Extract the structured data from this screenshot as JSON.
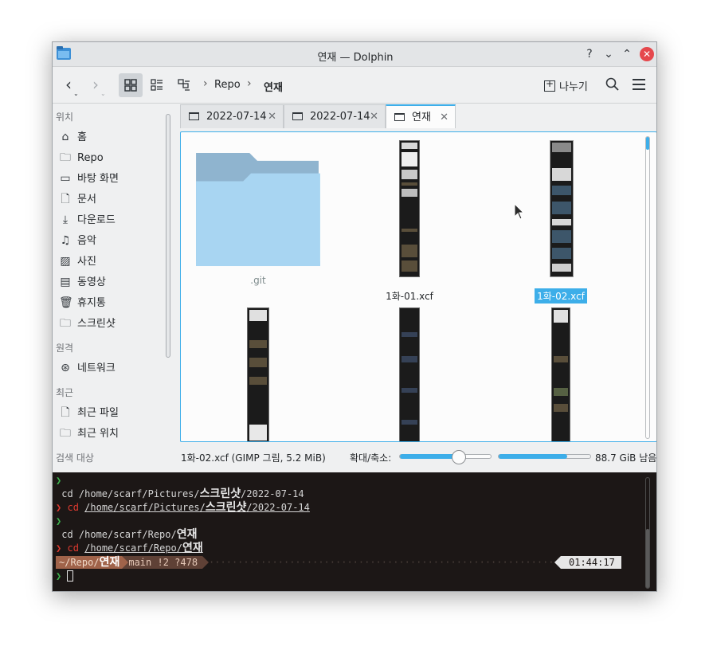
{
  "window": {
    "title": "연재 — Dolphin"
  },
  "titlebar": {
    "help": "?",
    "minimize": "⌄",
    "maximize": "⌃",
    "close": "✕"
  },
  "toolbar": {
    "breadcrumb": [
      "Repo",
      "연재"
    ],
    "split_label": "나누기"
  },
  "sidebar": {
    "sections": {
      "places": "위치",
      "remote": "원격",
      "recent": "최근",
      "search": "검색 대상"
    },
    "places": [
      {
        "label": "홈",
        "icon": "home-icon"
      },
      {
        "label": "Repo",
        "icon": "folder-icon"
      },
      {
        "label": "바탕 화면",
        "icon": "desktop-icon"
      },
      {
        "label": "문서",
        "icon": "documents-icon"
      },
      {
        "label": "다운로드",
        "icon": "download-icon"
      },
      {
        "label": "음악",
        "icon": "music-icon"
      },
      {
        "label": "사진",
        "icon": "pictures-icon"
      },
      {
        "label": "동영상",
        "icon": "video-icon"
      },
      {
        "label": "휴지통",
        "icon": "trash-icon"
      },
      {
        "label": "스크린샷",
        "icon": "folder-icon"
      }
    ],
    "remote": [
      {
        "label": "네트워크",
        "icon": "network-icon"
      }
    ],
    "recent": [
      {
        "label": "최근 파일",
        "icon": "recent-files-icon"
      },
      {
        "label": "최근 위치",
        "icon": "recent-locations-icon"
      }
    ]
  },
  "tabs": [
    {
      "label": "2022-07-14",
      "active": false
    },
    {
      "label": "2022-07-14",
      "active": false
    },
    {
      "label": "연재",
      "active": true
    }
  ],
  "files": [
    {
      "name": ".git",
      "type": "folder",
      "selected": false
    },
    {
      "name": "1화-01.xcf",
      "type": "image",
      "selected": false
    },
    {
      "name": "1화-02.xcf",
      "type": "image",
      "selected": true
    },
    {
      "name": "",
      "type": "image",
      "selected": false
    },
    {
      "name": "",
      "type": "image",
      "selected": false
    },
    {
      "name": "",
      "type": "image",
      "selected": false
    }
  ],
  "status": {
    "selection_info": "1화-02.xcf (GIMP 그림, 5.2 MiB)",
    "zoom_label": "확대/축소:",
    "zoom_fraction": 0.65,
    "space_used_fraction": 0.75,
    "free_space": "88.7 GiB 남음"
  },
  "terminal": {
    "prompt_char": "❯",
    "line1_prefix": " cd /home/scarf/Pictures/",
    "line1_hangul": "스크린샷",
    "line1_suffix": "/2022-07-14",
    "line2_cmd": "cd",
    "line2_path": "/home/scarf/Pictures/",
    "line2_hangul": "스크린샷",
    "line2_suffix": "/2022-07-14",
    "line3_prefix": " cd /home/scarf/Repo/",
    "line3_hangul": "연재",
    "line4_cmd": "cd",
    "line4_path": "/home/scarf/Repo/",
    "line4_hangul": "연재",
    "path_segment": "~/Repo/",
    "path_hangul": "연재",
    "git_segment": "main !2 ?478",
    "clock": "01:44:17"
  },
  "colors": {
    "accent": "#3daee9",
    "close_button": "#e5484d",
    "terminal_bg": "#1c1716",
    "prompt_green": "#3fb950",
    "prompt_red": "#e03a30"
  }
}
